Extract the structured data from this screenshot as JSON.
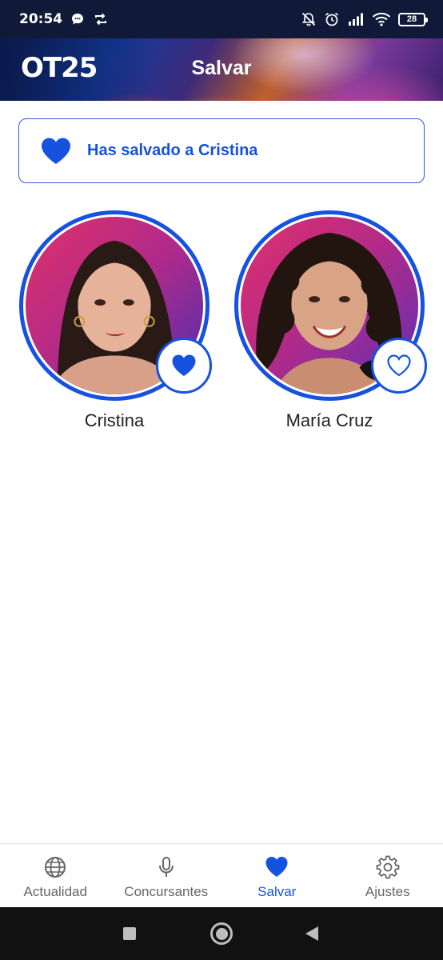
{
  "status_bar": {
    "time": "20:54",
    "battery": "28",
    "icons": [
      "chat-bubble-icon",
      "sync-icon",
      "alarm-off-icon",
      "alarm-icon",
      "signal-icon",
      "wifi-icon",
      "battery-icon"
    ]
  },
  "header": {
    "logo_text": "OT25",
    "title": "Salvar"
  },
  "notice": {
    "icon": "heart-filled-icon",
    "text": "Has salvado a Cristina"
  },
  "contestants": [
    {
      "name": "Cristina",
      "saved": true,
      "icon": "heart-filled-icon"
    },
    {
      "name": "María Cruz",
      "saved": false,
      "icon": "heart-outline-icon"
    }
  ],
  "bottom_nav": {
    "items": [
      {
        "label": "Actualidad",
        "icon": "globe-icon",
        "active": false
      },
      {
        "label": "Concursantes",
        "icon": "microphone-icon",
        "active": false
      },
      {
        "label": "Salvar",
        "icon": "heart-icon",
        "active": true
      },
      {
        "label": "Ajustes",
        "icon": "gear-icon",
        "active": false
      }
    ]
  },
  "colors": {
    "accent": "#1552e0",
    "status_bar": "#101a38",
    "nav_inactive": "#666666"
  }
}
